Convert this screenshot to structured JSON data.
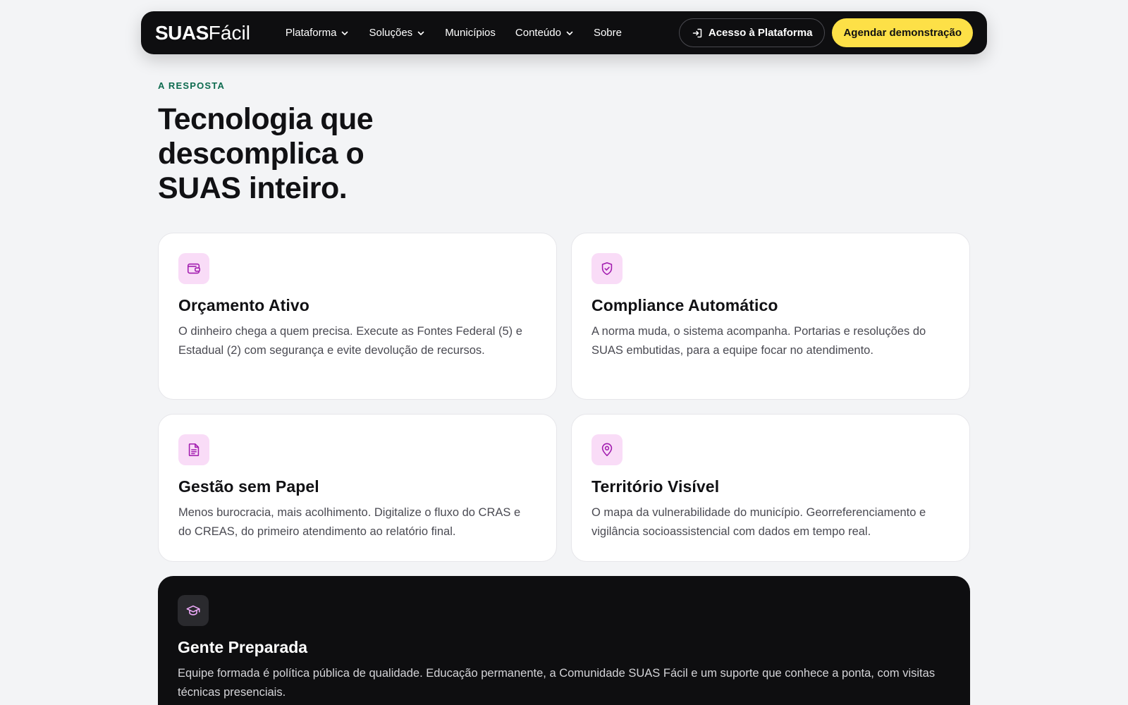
{
  "nav": {
    "logo_bold": "SUAS",
    "logo_light": "Fácil",
    "menu": [
      {
        "label": "Plataforma",
        "dropdown": true
      },
      {
        "label": "Soluções",
        "dropdown": true
      },
      {
        "label": "Municípios",
        "dropdown": false
      },
      {
        "label": "Conteúdo",
        "dropdown": true
      },
      {
        "label": "Sobre",
        "dropdown": false
      }
    ],
    "access_label": "Acesso à Plataforma",
    "demo_label": "Agendar demonstração"
  },
  "hero": {
    "eyebrow": "A RESPOSTA",
    "title": "Tecnologia que descomplica o SUAS inteiro."
  },
  "cards": [
    {
      "icon": "wallet-icon",
      "title": "Orçamento Ativo",
      "text": "O dinheiro chega a quem precisa. Execute as Fontes Federal (5) e Estadual (2) com segurança e evite devolução de recursos."
    },
    {
      "icon": "shield-check-icon",
      "title": "Compliance Automático",
      "text": "A norma muda, o sistema acompanha. Portarias e resoluções do SUAS embutidas, para a equipe focar no atendimento."
    },
    {
      "icon": "document-icon",
      "title": "Gestão sem Papel",
      "text": "Menos burocracia, mais acolhimento. Digitalize o fluxo do CRAS e do CREAS, do primeiro atendimento ao relatório final."
    },
    {
      "icon": "map-pin-icon",
      "title": "Território Visível",
      "text": "O mapa da vulnerabilidade do município. Georreferenciamento e vigilância socioassistencial com dados em tempo real."
    }
  ],
  "featured": {
    "icon": "graduation-cap-icon",
    "title": "Gente Preparada",
    "text": "Equipe formada é política pública de qualidade. Educação permanente, a Comunidade SUAS Fácil e um suporte que conhece a ponta, com visitas técnicas presenciais."
  },
  "colors": {
    "accent_yellow": "#fde047",
    "eyebrow_green": "#0d6b4f",
    "icon_bg": "#f9dcf7",
    "icon_stroke": "#a21caf",
    "dark_bg": "#0e0e10"
  }
}
